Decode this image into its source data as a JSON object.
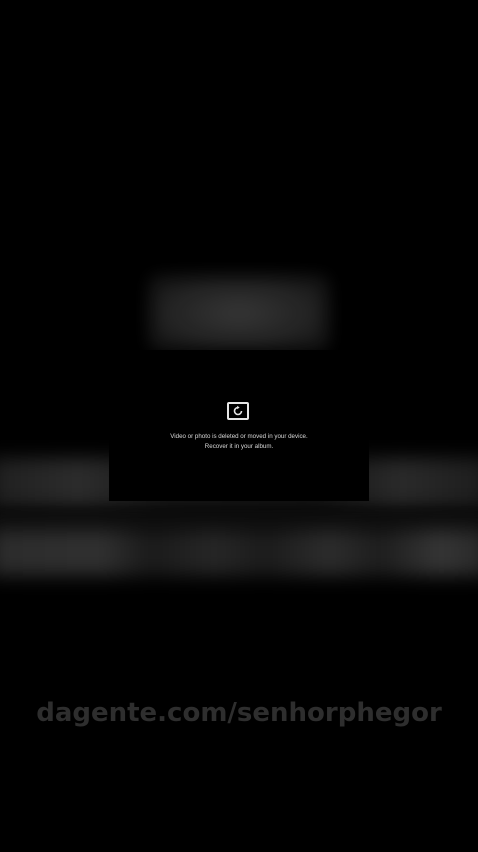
{
  "dialog": {
    "icon": "photo-recover-icon",
    "message_line1": "Video or photo is deleted or moved in your device.",
    "message_line2": "Recover it in your album."
  },
  "watermark": {
    "text": "dagente.com/senhorphegor"
  },
  "colors": {
    "background": "#000000",
    "dialog_text": "#d8d8d8",
    "watermark": "#2e2e2e"
  }
}
